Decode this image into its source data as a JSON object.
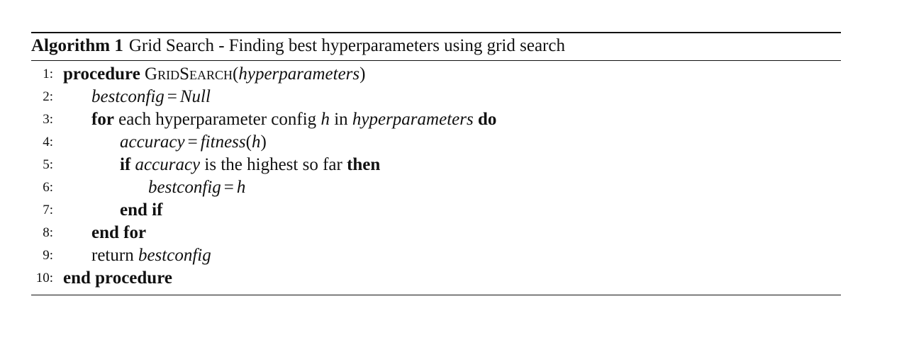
{
  "algorithm": {
    "label": "Algorithm 1",
    "title": "Grid Search - Finding best hyperparameters using grid search",
    "lines": [
      {
        "num": "1:",
        "kw1": "procedure",
        "name": "GridSearch",
        "open": "(",
        "arg": "hyperparameters",
        "close": ")"
      },
      {
        "num": "2:",
        "var": "bestconfig",
        "eq": "=",
        "val": "Null"
      },
      {
        "num": "3:",
        "kw_for": "for",
        "text1": "each hyperparameter config",
        "var_h": "h",
        "text_in": "in",
        "var_hp": "hyperparameters",
        "kw_do": "do"
      },
      {
        "num": "4:",
        "var": "accuracy",
        "eq": "=",
        "func": "fitness",
        "open": "(",
        "arg": "h",
        "close": ")"
      },
      {
        "num": "5:",
        "kw_if": "if",
        "var": "accuracy",
        "text": "is the highest so far",
        "kw_then": "then"
      },
      {
        "num": "6:",
        "var": "bestconfig",
        "eq": "=",
        "val": "h"
      },
      {
        "num": "7:",
        "kw": "end if"
      },
      {
        "num": "8:",
        "kw": "end for"
      },
      {
        "num": "9:",
        "text": "return",
        "var": "bestconfig"
      },
      {
        "num": "10:",
        "kw": "end procedure"
      }
    ]
  }
}
